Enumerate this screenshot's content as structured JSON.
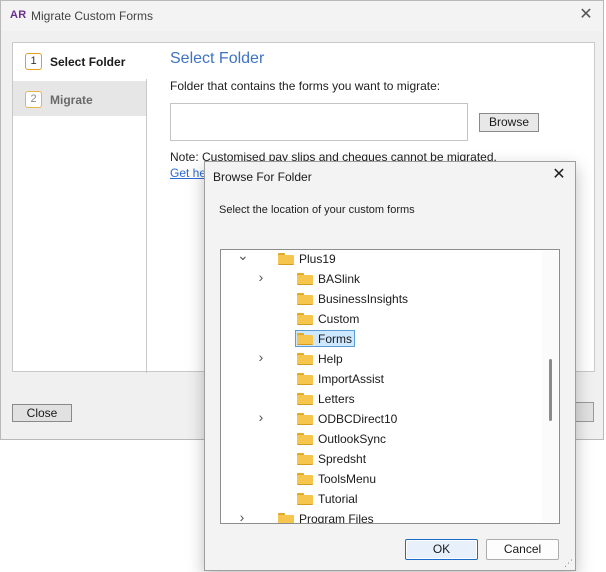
{
  "main_window": {
    "logo": "AR",
    "title": "Migrate Custom Forms",
    "close_glyph": "✕",
    "steps": [
      {
        "number": "1",
        "label": "Select Folder"
      },
      {
        "number": "2",
        "label": "Migrate"
      }
    ],
    "heading": "Select Folder",
    "folder_label": "Folder that contains the forms you want to migrate:",
    "folder_value": "",
    "browse_label": "Browse",
    "note": "Note: Customised pay slips and cheques cannot be migrated.",
    "help_link": "Get he",
    "close_label": "Close"
  },
  "dialog": {
    "title": "Browse For Folder",
    "close_glyph": "✕",
    "instruction": "Select the location of your custom forms",
    "tree": [
      {
        "label": "Plus19",
        "level": 1,
        "expander": "expanded"
      },
      {
        "label": "BASlink",
        "level": 2,
        "expander": "collapsed"
      },
      {
        "label": "BusinessInsights",
        "level": 2,
        "expander": "none"
      },
      {
        "label": "Custom",
        "level": 2,
        "expander": "none"
      },
      {
        "label": "Forms",
        "level": 2,
        "expander": "none",
        "selected": true
      },
      {
        "label": "Help",
        "level": 2,
        "expander": "collapsed"
      },
      {
        "label": "ImportAssist",
        "level": 2,
        "expander": "none"
      },
      {
        "label": "Letters",
        "level": 2,
        "expander": "none"
      },
      {
        "label": "ODBCDirect10",
        "level": 2,
        "expander": "collapsed"
      },
      {
        "label": "OutlookSync",
        "level": 2,
        "expander": "none"
      },
      {
        "label": "Spredsht",
        "level": 2,
        "expander": "none"
      },
      {
        "label": "ToolsMenu",
        "level": 2,
        "expander": "none"
      },
      {
        "label": "Tutorial",
        "level": 2,
        "expander": "none"
      },
      {
        "label": "Program Files",
        "level": 1,
        "expander": "collapsed"
      }
    ],
    "ok_label": "OK",
    "cancel_label": "Cancel"
  },
  "colors": {
    "heading": "#3e74c2",
    "link": "#2a6ad1",
    "folder": "#f5c54e",
    "selection": "#cde8ff",
    "step_badge_border": "#e0a020"
  },
  "icons": {
    "folder": "folder-icon",
    "expanded": "chevron-down-icon",
    "collapsed": "chevron-right-icon"
  }
}
